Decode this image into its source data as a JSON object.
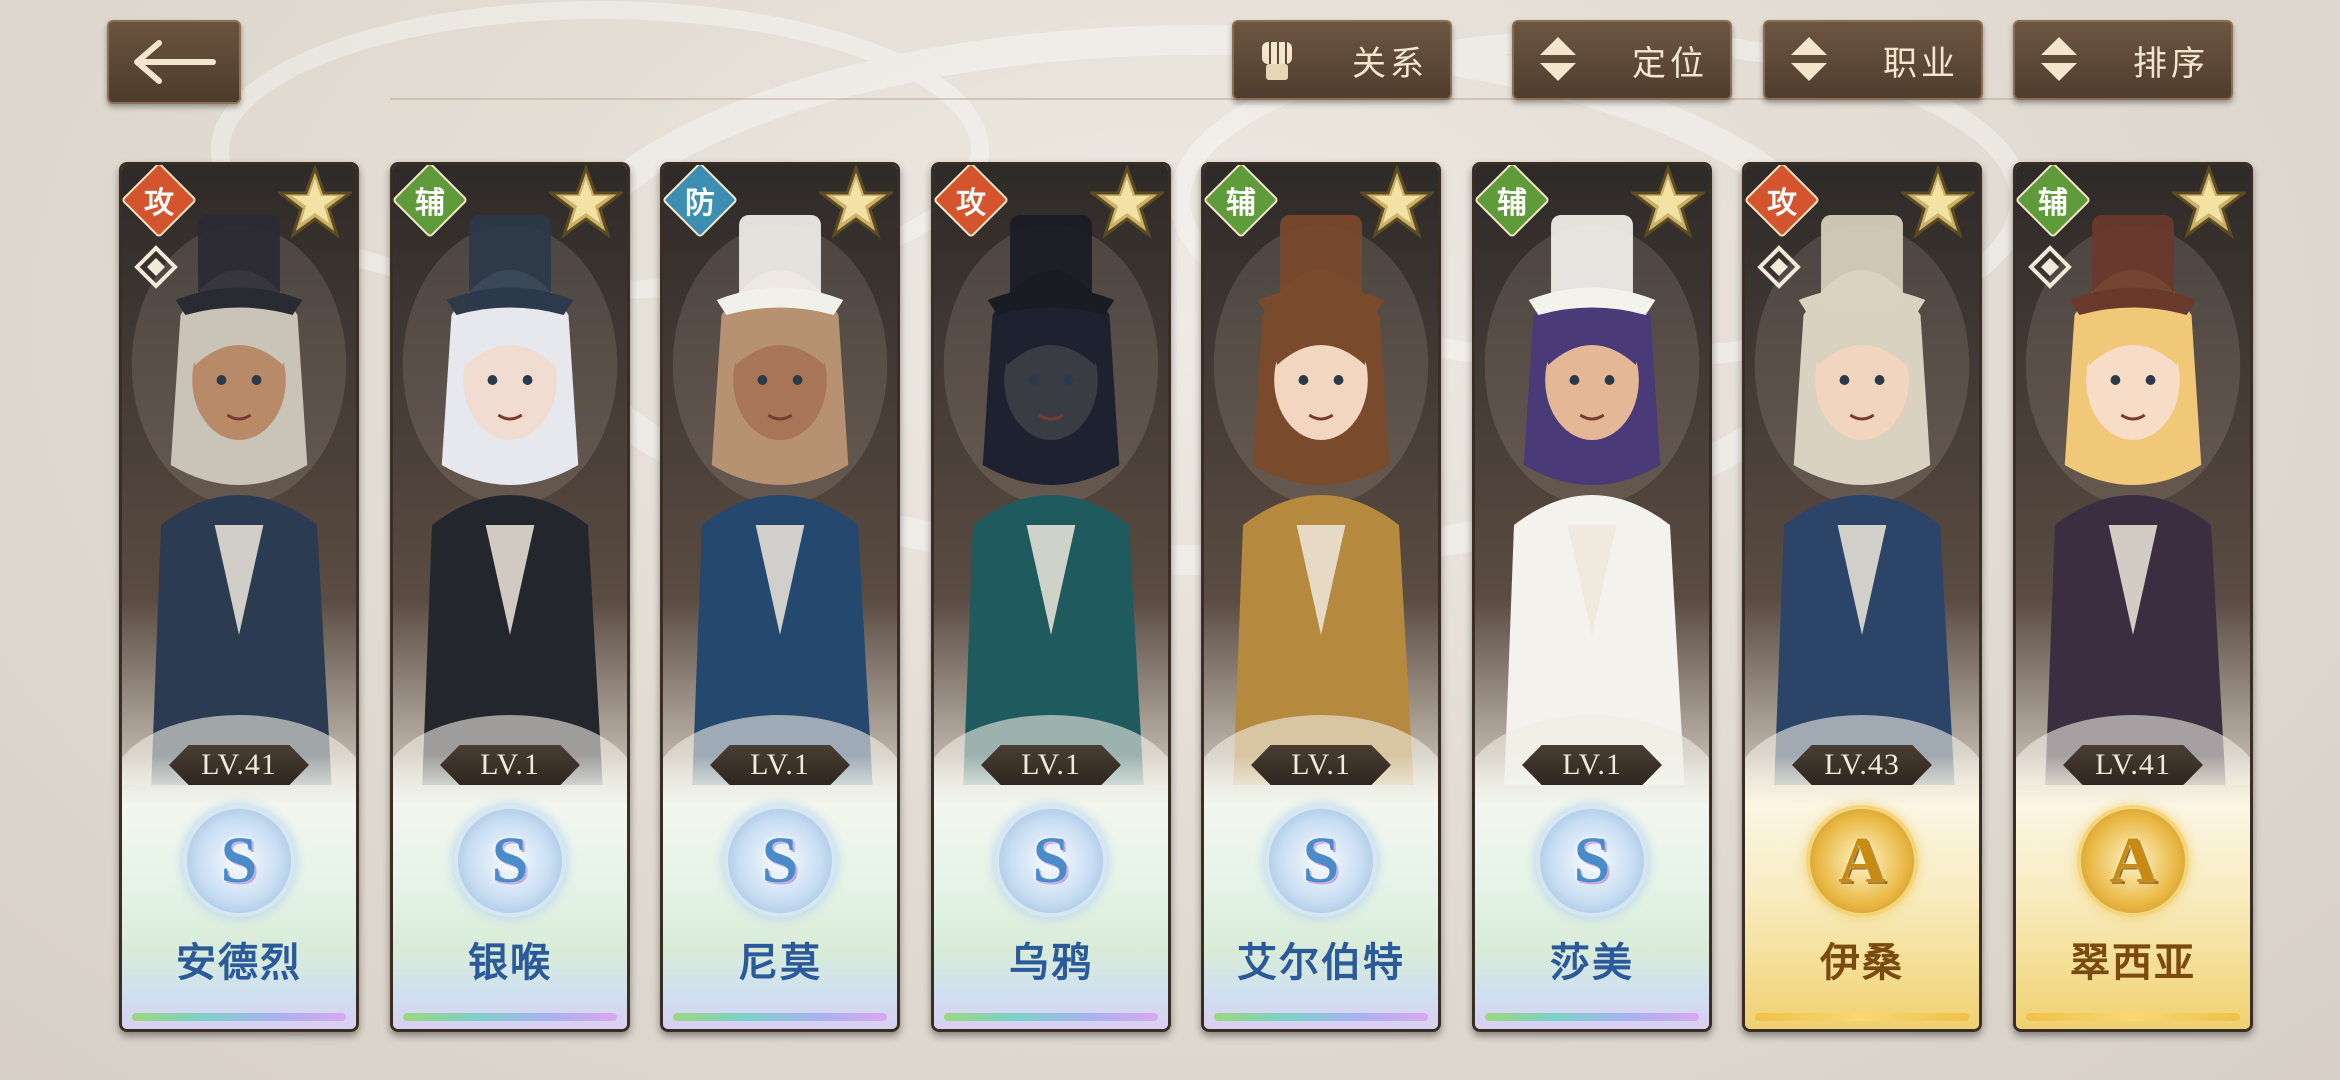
{
  "toolbar": {
    "relation_label": "关系",
    "position_label": "定位",
    "class_label": "职业",
    "sort_label": "排序"
  },
  "characters": [
    {
      "role": "攻",
      "role_type": "atk",
      "level": "LV.41",
      "rank": "S",
      "name": "安德烈",
      "relic": true,
      "hair": "#c9c3b8",
      "skin": "#b98a68",
      "outfit": "#2b3c52",
      "hat": "#2a2a33"
    },
    {
      "role": "辅",
      "role_type": "sup",
      "level": "LV.1",
      "rank": "S",
      "name": "银喉",
      "relic": false,
      "hair": "#e6e8ee",
      "skin": "#f1dcd2",
      "outfit": "#24262e",
      "hat": "#2c3a4a"
    },
    {
      "role": "防",
      "role_type": "def",
      "level": "LV.1",
      "rank": "S",
      "name": "尼莫",
      "relic": false,
      "hair": "#b69272",
      "skin": "#a87558",
      "outfit": "#24486e",
      "hat": "#f2f0ea"
    },
    {
      "role": "攻",
      "role_type": "atk",
      "level": "LV.1",
      "rank": "S",
      "name": "乌鸦",
      "relic": false,
      "hair": "#1e2230",
      "skin": "#3a3c44",
      "outfit": "#1f5a5e",
      "hat": "#1a1c24"
    },
    {
      "role": "辅",
      "role_type": "sup",
      "level": "LV.1",
      "rank": "S",
      "name": "艾尔伯特",
      "relic": false,
      "hair": "#7a4a2c",
      "skin": "#f3d6c0",
      "outfit": "#b58a3e",
      "hat": "#7a4a2c"
    },
    {
      "role": "辅",
      "role_type": "sup",
      "level": "LV.1",
      "rank": "S",
      "name": "莎美",
      "relic": false,
      "hair": "#4a3a78",
      "skin": "#e4b896",
      "outfit": "#f4f2ec",
      "hat": "#f4f2ec"
    },
    {
      "role": "攻",
      "role_type": "atk",
      "level": "LV.43",
      "rank": "A",
      "name": "伊桑",
      "relic": true,
      "hair": "#d9d2c0",
      "skin": "#f2d5bf",
      "outfit": "#2b4468",
      "hat": "#d9d2c0"
    },
    {
      "role": "辅",
      "role_type": "sup",
      "level": "LV.41",
      "rank": "A",
      "name": "翠西亚",
      "relic": true,
      "hair": "#f0c878",
      "skin": "#f7dcc8",
      "outfit": "#3a2e40",
      "hat": "#6a3a2c"
    }
  ],
  "colors": {
    "toolbar_bg": "#5c4835",
    "role_attack": "#d4552d",
    "role_support": "#5f9b3a",
    "role_defense": "#3c8fb3",
    "name_s": "#2a5a9a",
    "name_a": "#7a4a10"
  },
  "icons": {
    "back": "back-arrow-icon",
    "relation": "fist-icon",
    "filter": "up-down-triangle-icon",
    "star": "star-icon",
    "relic": "diamond-relic-icon"
  }
}
